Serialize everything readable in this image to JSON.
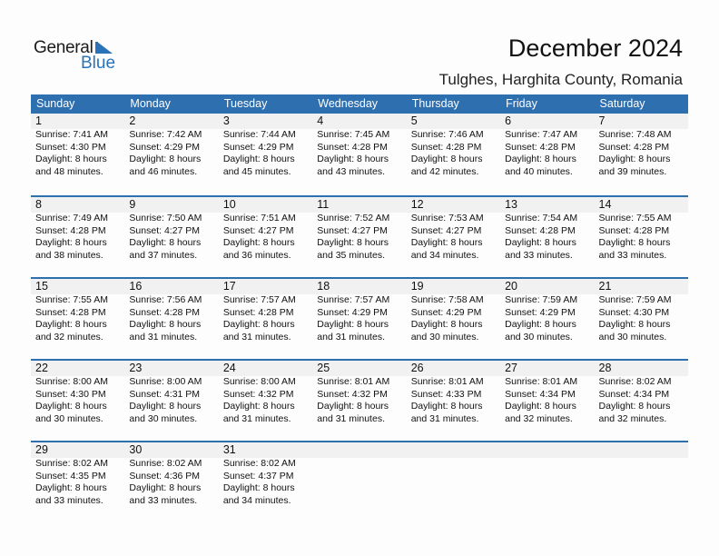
{
  "logo": {
    "word1": "General",
    "word2": "Blue"
  },
  "header": {
    "title": "December 2024",
    "location": "Tulghes, Harghita County, Romania"
  },
  "colors": {
    "accent": "#2e6fb0",
    "date_band": "#f1f1f1",
    "logo_blue": "#2a73b8"
  },
  "weekdays": [
    "Sunday",
    "Monday",
    "Tuesday",
    "Wednesday",
    "Thursday",
    "Friday",
    "Saturday"
  ],
  "weeks": [
    [
      {
        "day": "1",
        "sunrise": "Sunrise: 7:41 AM",
        "sunset": "Sunset: 4:30 PM",
        "daylight1": "Daylight: 8 hours",
        "daylight2": "and 48 minutes."
      },
      {
        "day": "2",
        "sunrise": "Sunrise: 7:42 AM",
        "sunset": "Sunset: 4:29 PM",
        "daylight1": "Daylight: 8 hours",
        "daylight2": "and 46 minutes."
      },
      {
        "day": "3",
        "sunrise": "Sunrise: 7:44 AM",
        "sunset": "Sunset: 4:29 PM",
        "daylight1": "Daylight: 8 hours",
        "daylight2": "and 45 minutes."
      },
      {
        "day": "4",
        "sunrise": "Sunrise: 7:45 AM",
        "sunset": "Sunset: 4:28 PM",
        "daylight1": "Daylight: 8 hours",
        "daylight2": "and 43 minutes."
      },
      {
        "day": "5",
        "sunrise": "Sunrise: 7:46 AM",
        "sunset": "Sunset: 4:28 PM",
        "daylight1": "Daylight: 8 hours",
        "daylight2": "and 42 minutes."
      },
      {
        "day": "6",
        "sunrise": "Sunrise: 7:47 AM",
        "sunset": "Sunset: 4:28 PM",
        "daylight1": "Daylight: 8 hours",
        "daylight2": "and 40 minutes."
      },
      {
        "day": "7",
        "sunrise": "Sunrise: 7:48 AM",
        "sunset": "Sunset: 4:28 PM",
        "daylight1": "Daylight: 8 hours",
        "daylight2": "and 39 minutes."
      }
    ],
    [
      {
        "day": "8",
        "sunrise": "Sunrise: 7:49 AM",
        "sunset": "Sunset: 4:28 PM",
        "daylight1": "Daylight: 8 hours",
        "daylight2": "and 38 minutes."
      },
      {
        "day": "9",
        "sunrise": "Sunrise: 7:50 AM",
        "sunset": "Sunset: 4:27 PM",
        "daylight1": "Daylight: 8 hours",
        "daylight2": "and 37 minutes."
      },
      {
        "day": "10",
        "sunrise": "Sunrise: 7:51 AM",
        "sunset": "Sunset: 4:27 PM",
        "daylight1": "Daylight: 8 hours",
        "daylight2": "and 36 minutes."
      },
      {
        "day": "11",
        "sunrise": "Sunrise: 7:52 AM",
        "sunset": "Sunset: 4:27 PM",
        "daylight1": "Daylight: 8 hours",
        "daylight2": "and 35 minutes."
      },
      {
        "day": "12",
        "sunrise": "Sunrise: 7:53 AM",
        "sunset": "Sunset: 4:27 PM",
        "daylight1": "Daylight: 8 hours",
        "daylight2": "and 34 minutes."
      },
      {
        "day": "13",
        "sunrise": "Sunrise: 7:54 AM",
        "sunset": "Sunset: 4:28 PM",
        "daylight1": "Daylight: 8 hours",
        "daylight2": "and 33 minutes."
      },
      {
        "day": "14",
        "sunrise": "Sunrise: 7:55 AM",
        "sunset": "Sunset: 4:28 PM",
        "daylight1": "Daylight: 8 hours",
        "daylight2": "and 33 minutes."
      }
    ],
    [
      {
        "day": "15",
        "sunrise": "Sunrise: 7:55 AM",
        "sunset": "Sunset: 4:28 PM",
        "daylight1": "Daylight: 8 hours",
        "daylight2": "and 32 minutes."
      },
      {
        "day": "16",
        "sunrise": "Sunrise: 7:56 AM",
        "sunset": "Sunset: 4:28 PM",
        "daylight1": "Daylight: 8 hours",
        "daylight2": "and 31 minutes."
      },
      {
        "day": "17",
        "sunrise": "Sunrise: 7:57 AM",
        "sunset": "Sunset: 4:28 PM",
        "daylight1": "Daylight: 8 hours",
        "daylight2": "and 31 minutes."
      },
      {
        "day": "18",
        "sunrise": "Sunrise: 7:57 AM",
        "sunset": "Sunset: 4:29 PM",
        "daylight1": "Daylight: 8 hours",
        "daylight2": "and 31 minutes."
      },
      {
        "day": "19",
        "sunrise": "Sunrise: 7:58 AM",
        "sunset": "Sunset: 4:29 PM",
        "daylight1": "Daylight: 8 hours",
        "daylight2": "and 30 minutes."
      },
      {
        "day": "20",
        "sunrise": "Sunrise: 7:59 AM",
        "sunset": "Sunset: 4:29 PM",
        "daylight1": "Daylight: 8 hours",
        "daylight2": "and 30 minutes."
      },
      {
        "day": "21",
        "sunrise": "Sunrise: 7:59 AM",
        "sunset": "Sunset: 4:30 PM",
        "daylight1": "Daylight: 8 hours",
        "daylight2": "and 30 minutes."
      }
    ],
    [
      {
        "day": "22",
        "sunrise": "Sunrise: 8:00 AM",
        "sunset": "Sunset: 4:30 PM",
        "daylight1": "Daylight: 8 hours",
        "daylight2": "and 30 minutes."
      },
      {
        "day": "23",
        "sunrise": "Sunrise: 8:00 AM",
        "sunset": "Sunset: 4:31 PM",
        "daylight1": "Daylight: 8 hours",
        "daylight2": "and 30 minutes."
      },
      {
        "day": "24",
        "sunrise": "Sunrise: 8:00 AM",
        "sunset": "Sunset: 4:32 PM",
        "daylight1": "Daylight: 8 hours",
        "daylight2": "and 31 minutes."
      },
      {
        "day": "25",
        "sunrise": "Sunrise: 8:01 AM",
        "sunset": "Sunset: 4:32 PM",
        "daylight1": "Daylight: 8 hours",
        "daylight2": "and 31 minutes."
      },
      {
        "day": "26",
        "sunrise": "Sunrise: 8:01 AM",
        "sunset": "Sunset: 4:33 PM",
        "daylight1": "Daylight: 8 hours",
        "daylight2": "and 31 minutes."
      },
      {
        "day": "27",
        "sunrise": "Sunrise: 8:01 AM",
        "sunset": "Sunset: 4:34 PM",
        "daylight1": "Daylight: 8 hours",
        "daylight2": "and 32 minutes."
      },
      {
        "day": "28",
        "sunrise": "Sunrise: 8:02 AM",
        "sunset": "Sunset: 4:34 PM",
        "daylight1": "Daylight: 8 hours",
        "daylight2": "and 32 minutes."
      }
    ],
    [
      {
        "day": "29",
        "sunrise": "Sunrise: 8:02 AM",
        "sunset": "Sunset: 4:35 PM",
        "daylight1": "Daylight: 8 hours",
        "daylight2": "and 33 minutes."
      },
      {
        "day": "30",
        "sunrise": "Sunrise: 8:02 AM",
        "sunset": "Sunset: 4:36 PM",
        "daylight1": "Daylight: 8 hours",
        "daylight2": "and 33 minutes."
      },
      {
        "day": "31",
        "sunrise": "Sunrise: 8:02 AM",
        "sunset": "Sunset: 4:37 PM",
        "daylight1": "Daylight: 8 hours",
        "daylight2": "and 34 minutes."
      },
      {},
      {},
      {},
      {}
    ]
  ]
}
